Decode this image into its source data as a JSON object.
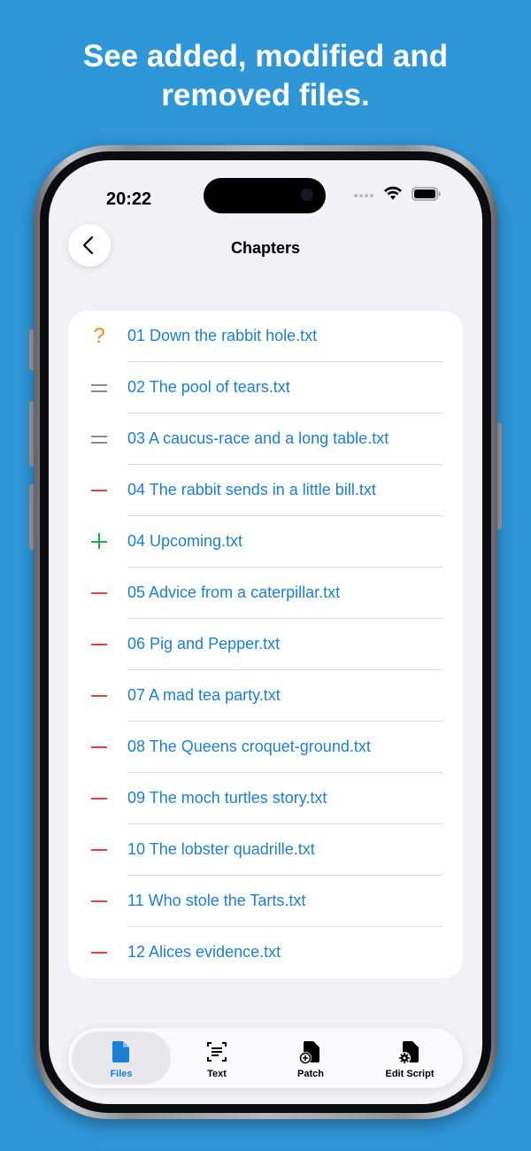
{
  "headline": {
    "line1": "See added, modified and",
    "line2": "removed files."
  },
  "status_bar": {
    "time": "20:22"
  },
  "nav": {
    "title": "Chapters"
  },
  "files": [
    {
      "status": "untracked",
      "name": "01 Down the rabbit hole.txt"
    },
    {
      "status": "unchanged",
      "name": "02 The pool of tears.txt"
    },
    {
      "status": "unchanged",
      "name": "03 A caucus-race and a long table.txt"
    },
    {
      "status": "removed",
      "name": "04 The rabbit sends in a little bill.txt"
    },
    {
      "status": "added",
      "name": "04 Upcoming.txt"
    },
    {
      "status": "removed",
      "name": "05 Advice from a caterpillar.txt"
    },
    {
      "status": "removed",
      "name": "06 Pig and Pepper.txt"
    },
    {
      "status": "removed",
      "name": "07 A mad tea party.txt"
    },
    {
      "status": "removed",
      "name": "08 The Queens croquet-ground.txt"
    },
    {
      "status": "removed",
      "name": "09 The moch turtles story.txt"
    },
    {
      "status": "removed",
      "name": "10 The lobster quadrille.txt"
    },
    {
      "status": "removed",
      "name": "11 Who stole the Tarts.txt"
    },
    {
      "status": "removed",
      "name": "12 Alices evidence.txt"
    }
  ],
  "tabs": [
    {
      "label": "Files",
      "icon": "file-icon",
      "active": true
    },
    {
      "label": "Text",
      "icon": "text-scan-icon",
      "active": false
    },
    {
      "label": "Patch",
      "icon": "patch-file-icon",
      "active": false
    },
    {
      "label": "Edit Script",
      "icon": "edit-script-icon",
      "active": false
    }
  ],
  "colors": {
    "background": "#2f96d8",
    "accent": "#1a7fd6",
    "untracked": "#f08c1d",
    "unchanged": "#8c8c90",
    "removed": "#ef3b3b",
    "added": "#23b043"
  }
}
